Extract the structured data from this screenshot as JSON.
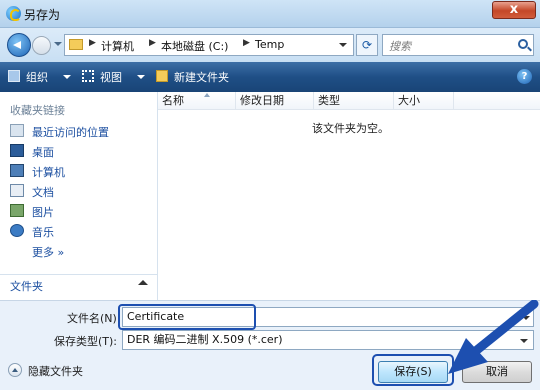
{
  "window": {
    "title": "另存为",
    "close_label": "x"
  },
  "address": {
    "crumbs": [
      "计算机",
      "本地磁盘 (C:)",
      "Temp"
    ],
    "search_placeholder": "搜索"
  },
  "toolbar": {
    "organize": "组织",
    "views": "视图",
    "new_folder": "新建文件夹"
  },
  "sidebar": {
    "header": "收藏夹链接",
    "items": [
      {
        "label": "最近访问的位置",
        "icon": "recent-places-icon"
      },
      {
        "label": "桌面",
        "icon": "desktop-icon"
      },
      {
        "label": "计算机",
        "icon": "computer-icon"
      },
      {
        "label": "文档",
        "icon": "documents-icon"
      },
      {
        "label": "图片",
        "icon": "pictures-icon"
      },
      {
        "label": "音乐",
        "icon": "music-icon"
      }
    ],
    "more": "更多 »",
    "folders": "文件夹"
  },
  "filelist": {
    "columns": [
      "名称",
      "修改日期",
      "类型",
      "大小"
    ],
    "empty_message": "该文件夹为空。"
  },
  "form": {
    "filename_label": "文件名(N):",
    "filename_value": "Certificate",
    "filetype_label": "保存类型(T):",
    "filetype_value": "DER 编码二进制 X.509 (*.cer)"
  },
  "footer": {
    "hide_folders": "隐藏文件夹",
    "save": "保存(S)",
    "cancel": "取消"
  },
  "colors": {
    "highlight": "#1d4fb0",
    "toolbar": "#1f4f86",
    "link": "#1c4fa0"
  }
}
